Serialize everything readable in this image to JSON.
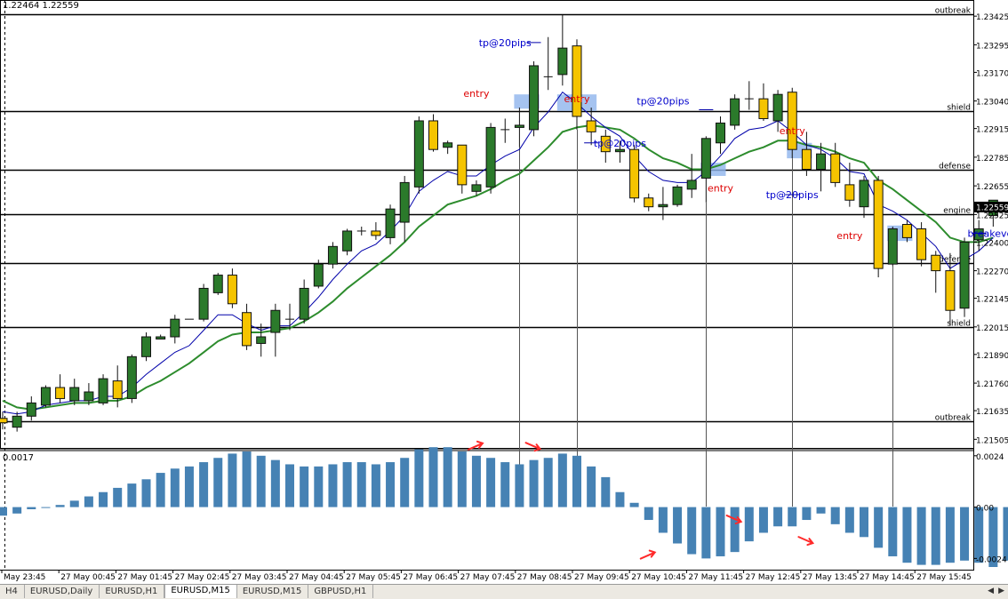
{
  "header": {
    "price_readout": "1.22464 1.22559",
    "indicator_readout": "0.0017"
  },
  "colors": {
    "bull": "#2b7a2b",
    "bear": "#f5c400",
    "wick": "#111111",
    "ma_fast": "#0000aa",
    "ma_slow": "#2d8c2d",
    "histogram": "#4682b4",
    "entry_text": "#dd0000",
    "tp_text": "#0000cc",
    "arrow": "#ff2a2a",
    "zone": "#8fb4ec"
  },
  "tabs": [
    {
      "label": "H4",
      "active": false
    },
    {
      "label": "EURUSD,Daily",
      "active": false
    },
    {
      "label": "EURUSD,H1",
      "active": false
    },
    {
      "label": "EURUSD,M15",
      "active": true
    },
    {
      "label": "EURUSD,M15",
      "active": false
    },
    {
      "label": "GBPUSD,H1",
      "active": false
    }
  ],
  "chart_data": {
    "type": "candlestick",
    "symbol_tab": "EURUSD,M15",
    "price_axis": {
      "ylim": [
        1.2147,
        1.2347
      ],
      "ticks": [
        "1.23425",
        "1.23295",
        "1.23170",
        "1.23040",
        "1.22915",
        "1.22785",
        "1.22655",
        "1.22525",
        "1.22400",
        "1.22270",
        "1.22145",
        "1.22015",
        "1.21890",
        "1.21760",
        "1.21635",
        "1.21505"
      ],
      "current_price": "1.22559"
    },
    "time_labels": [
      "May 23:45",
      "27 May 00:45",
      "27 May 01:45",
      "27 May 02:45",
      "27 May 03:45",
      "27 May 04:45",
      "27 May 05:45",
      "27 May 06:45",
      "27 May 07:45",
      "27 May 08:45",
      "27 May 09:45",
      "27 May 10:45",
      "27 May 11:45",
      "27 May 12:45",
      "27 May 13:45",
      "27 May 14:45",
      "27 May 15:45"
    ],
    "candles": [
      {
        "o": 1.216,
        "h": 1.2163,
        "l": 1.2155,
        "c": 1.2158
      },
      {
        "o": 1.2156,
        "h": 1.2163,
        "l": 1.2154,
        "c": 1.2161
      },
      {
        "o": 1.2161,
        "h": 1.217,
        "l": 1.2159,
        "c": 1.2167
      },
      {
        "o": 1.2166,
        "h": 1.2175,
        "l": 1.2165,
        "c": 1.2174
      },
      {
        "o": 1.2174,
        "h": 1.218,
        "l": 1.2167,
        "c": 1.2169
      },
      {
        "o": 1.2168,
        "h": 1.2178,
        "l": 1.2166,
        "c": 1.2174
      },
      {
        "o": 1.2168,
        "h": 1.2176,
        "l": 1.2166,
        "c": 1.2172
      },
      {
        "o": 1.2167,
        "h": 1.218,
        "l": 1.2166,
        "c": 1.2178
      },
      {
        "o": 1.2177,
        "h": 1.2184,
        "l": 1.2165,
        "c": 1.2169
      },
      {
        "o": 1.2169,
        "h": 1.2189,
        "l": 1.2167,
        "c": 1.2188
      },
      {
        "o": 1.2188,
        "h": 1.2199,
        "l": 1.2186,
        "c": 1.2197
      },
      {
        "o": 1.2196,
        "h": 1.2198,
        "l": 1.2196,
        "c": 1.2197
      },
      {
        "o": 1.2197,
        "h": 1.2207,
        "l": 1.2194,
        "c": 1.2205
      },
      {
        "o": 1.2205,
        "h": 1.2205,
        "l": 1.2205,
        "c": 1.2205
      },
      {
        "o": 1.2205,
        "h": 1.2221,
        "l": 1.2204,
        "c": 1.2219
      },
      {
        "o": 1.2217,
        "h": 1.2226,
        "l": 1.2216,
        "c": 1.2225
      },
      {
        "o": 1.2225,
        "h": 1.2228,
        "l": 1.221,
        "c": 1.2212
      },
      {
        "o": 1.2208,
        "h": 1.2212,
        "l": 1.2191,
        "c": 1.2193
      },
      {
        "o": 1.2194,
        "h": 1.2203,
        "l": 1.2188,
        "c": 1.2197
      },
      {
        "o": 1.2199,
        "h": 1.2212,
        "l": 1.2188,
        "c": 1.2209
      },
      {
        "o": 1.2205,
        "h": 1.2212,
        "l": 1.22,
        "c": 1.2205
      },
      {
        "o": 1.2205,
        "h": 1.2223,
        "l": 1.2203,
        "c": 1.2219
      },
      {
        "o": 1.222,
        "h": 1.2232,
        "l": 1.2219,
        "c": 1.223
      },
      {
        "o": 1.223,
        "h": 1.224,
        "l": 1.2228,
        "c": 1.2238
      },
      {
        "o": 1.2236,
        "h": 1.2246,
        "l": 1.2234,
        "c": 1.2245
      },
      {
        "o": 1.2245,
        "h": 1.2247,
        "l": 1.2243,
        "c": 1.2245
      },
      {
        "o": 1.2245,
        "h": 1.2249,
        "l": 1.2241,
        "c": 1.2243
      },
      {
        "o": 1.2242,
        "h": 1.2257,
        "l": 1.2239,
        "c": 1.2255
      },
      {
        "o": 1.2249,
        "h": 1.227,
        "l": 1.224,
        "c": 1.2267
      },
      {
        "o": 1.2265,
        "h": 1.2297,
        "l": 1.2262,
        "c": 1.2295
      },
      {
        "o": 1.2295,
        "h": 1.2298,
        "l": 1.2281,
        "c": 1.2282
      },
      {
        "o": 1.2283,
        "h": 1.2286,
        "l": 1.228,
        "c": 1.2285
      },
      {
        "o": 1.2284,
        "h": 1.2284,
        "l": 1.2262,
        "c": 1.2266
      },
      {
        "o": 1.2263,
        "h": 1.2268,
        "l": 1.2261,
        "c": 1.2266
      },
      {
        "o": 1.2265,
        "h": 1.2294,
        "l": 1.2262,
        "c": 1.2292
      },
      {
        "o": 1.2291,
        "h": 1.2296,
        "l": 1.2285,
        "c": 1.2291
      },
      {
        "o": 1.2292,
        "h": 1.2301,
        "l": 1.2283,
        "c": 1.2293
      },
      {
        "o": 1.2291,
        "h": 1.2322,
        "l": 1.2288,
        "c": 1.232
      },
      {
        "o": 1.2315,
        "h": 1.2333,
        "l": 1.2309,
        "c": 1.2315
      },
      {
        "o": 1.2316,
        "h": 1.2343,
        "l": 1.2311,
        "c": 1.2328
      },
      {
        "o": 1.2329,
        "h": 1.2332,
        "l": 1.2291,
        "c": 1.2297
      },
      {
        "o": 1.2295,
        "h": 1.2301,
        "l": 1.2284,
        "c": 1.229
      },
      {
        "o": 1.2288,
        "h": 1.2291,
        "l": 1.2276,
        "c": 1.2281
      },
      {
        "o": 1.2281,
        "h": 1.2286,
        "l": 1.2276,
        "c": 1.2282
      },
      {
        "o": 1.2282,
        "h": 1.2284,
        "l": 1.2258,
        "c": 1.226
      },
      {
        "o": 1.226,
        "h": 1.2262,
        "l": 1.2254,
        "c": 1.2256
      },
      {
        "o": 1.2256,
        "h": 1.2265,
        "l": 1.225,
        "c": 1.2257
      },
      {
        "o": 1.2257,
        "h": 1.2266,
        "l": 1.2256,
        "c": 1.2265
      },
      {
        "o": 1.2264,
        "h": 1.228,
        "l": 1.226,
        "c": 1.2268
      },
      {
        "o": 1.2269,
        "h": 1.2288,
        "l": 1.2258,
        "c": 1.2287
      },
      {
        "o": 1.2285,
        "h": 1.2297,
        "l": 1.228,
        "c": 1.2294
      },
      {
        "o": 1.2293,
        "h": 1.2307,
        "l": 1.2291,
        "c": 1.2305
      },
      {
        "o": 1.2305,
        "h": 1.2313,
        "l": 1.23,
        "c": 1.2305
      },
      {
        "o": 1.2305,
        "h": 1.2312,
        "l": 1.2295,
        "c": 1.2296
      },
      {
        "o": 1.2295,
        "h": 1.2309,
        "l": 1.229,
        "c": 1.2307
      },
      {
        "o": 1.2308,
        "h": 1.231,
        "l": 1.2278,
        "c": 1.2282
      },
      {
        "o": 1.2282,
        "h": 1.229,
        "l": 1.227,
        "c": 1.2273
      },
      {
        "o": 1.2273,
        "h": 1.2285,
        "l": 1.2263,
        "c": 1.228
      },
      {
        "o": 1.228,
        "h": 1.2285,
        "l": 1.2265,
        "c": 1.2267
      },
      {
        "o": 1.2266,
        "h": 1.2276,
        "l": 1.2256,
        "c": 1.2259
      },
      {
        "o": 1.2256,
        "h": 1.227,
        "l": 1.2251,
        "c": 1.2268
      },
      {
        "o": 1.2268,
        "h": 1.227,
        "l": 1.2224,
        "c": 1.2228
      },
      {
        "o": 1.223,
        "h": 1.2247,
        "l": 1.2229,
        "c": 1.2246
      },
      {
        "o": 1.2248,
        "h": 1.225,
        "l": 1.224,
        "c": 1.2242
      },
      {
        "o": 1.2246,
        "h": 1.2249,
        "l": 1.2229,
        "c": 1.2232
      },
      {
        "o": 1.2234,
        "h": 1.2236,
        "l": 1.2217,
        "c": 1.2227
      },
      {
        "o": 1.2227,
        "h": 1.2235,
        "l": 1.2202,
        "c": 1.2209
      },
      {
        "o": 1.221,
        "h": 1.2242,
        "l": 1.2206,
        "c": 1.224
      },
      {
        "o": 1.2241,
        "h": 1.225,
        "l": 1.2236,
        "c": 1.2246
      },
      {
        "o": 1.2252,
        "h": 1.2259,
        "l": 1.2247,
        "c": 1.2259
      }
    ],
    "ma_fast": [
      1.2163,
      1.2162,
      1.2163,
      1.2166,
      1.2167,
      1.2168,
      1.2168,
      1.217,
      1.217,
      1.2174,
      1.218,
      1.2185,
      1.219,
      1.2193,
      1.22,
      1.2207,
      1.2207,
      1.2203,
      1.22,
      1.2202,
      1.2202,
      1.2208,
      1.2215,
      1.2223,
      1.223,
      1.2236,
      1.2239,
      1.2245,
      1.2252,
      1.2263,
      1.2268,
      1.2272,
      1.227,
      1.227,
      1.2275,
      1.2279,
      1.2282,
      1.2292,
      1.2299,
      1.2308,
      1.2303,
      1.2297,
      1.2292,
      1.2288,
      1.2279,
      1.2272,
      1.2268,
      1.2267,
      1.2267,
      1.2272,
      1.2279,
      1.2287,
      1.2291,
      1.2292,
      1.2295,
      1.229,
      1.2284,
      1.2282,
      1.2278,
      1.2272,
      1.2271,
      1.2257,
      1.2254,
      1.225,
      1.2244,
      1.2238,
      1.2228,
      1.2232,
      1.2236,
      1.2242
    ],
    "ma_slow": [
      1.2168,
      1.2165,
      1.2164,
      1.2165,
      1.2166,
      1.2167,
      1.2167,
      1.2168,
      1.2168,
      1.217,
      1.2174,
      1.2177,
      1.2181,
      1.2185,
      1.219,
      1.2195,
      1.2198,
      1.2199,
      1.2199,
      1.22,
      1.2201,
      1.2204,
      1.2208,
      1.2213,
      1.2219,
      1.2224,
      1.2229,
      1.2234,
      1.224,
      1.2247,
      1.2252,
      1.2257,
      1.2259,
      1.2261,
      1.2264,
      1.2268,
      1.2271,
      1.2277,
      1.2283,
      1.229,
      1.2292,
      1.2293,
      1.2292,
      1.2291,
      1.2287,
      1.2282,
      1.2278,
      1.2276,
      1.2273,
      1.2273,
      1.2275,
      1.2278,
      1.2281,
      1.2283,
      1.2286,
      1.2286,
      1.2284,
      1.2283,
      1.2281,
      1.2278,
      1.2276,
      1.2268,
      1.2264,
      1.2259,
      1.2254,
      1.2249,
      1.2242,
      1.224,
      1.224,
      1.2242
    ],
    "levels": [
      {
        "label": "outbreak",
        "price": 1.23435
      },
      {
        "label": "shield",
        "price": 1.22995
      },
      {
        "label": "defense",
        "price": 1.2273
      },
      {
        "label": "engine",
        "price": 1.22525
      },
      {
        "label": "defense",
        "price": 1.22305
      },
      {
        "label": "shield",
        "price": 1.22015
      },
      {
        "label": "outbreak",
        "price": 1.21585
      }
    ],
    "annotations": [
      {
        "text": "tp@20pips",
        "kind": "tp",
        "candle": 35,
        "price": 1.23305
      },
      {
        "text": "entry",
        "kind": "entry",
        "candle": 33,
        "price": 1.23075
      },
      {
        "text": "entry",
        "kind": "entry",
        "candle": 40,
        "price": 1.2305
      },
      {
        "text": "tp@20pips",
        "kind": "tp",
        "candle": 43,
        "price": 1.2285
      },
      {
        "text": "tp@20pips",
        "kind": "tp",
        "candle": 46,
        "price": 1.2304
      },
      {
        "text": "entry",
        "kind": "entry",
        "candle": 55,
        "price": 1.22905
      },
      {
        "text": "entry",
        "kind": "entry",
        "candle": 50,
        "price": 1.22645
      },
      {
        "text": "tp@20pips",
        "kind": "tp",
        "candle": 55,
        "price": 1.22615
      },
      {
        "text": "entry",
        "kind": "entry",
        "candle": 59,
        "price": 1.2243
      },
      {
        "text": "breakeven",
        "kind": "tp",
        "candle": 69,
        "price": 1.2244
      }
    ],
    "entry_zones": [
      {
        "from": 36,
        "to": 37,
        "low": 1.23005,
        "high": 1.2307
      },
      {
        "from": 39,
        "to": 41,
        "low": 1.22995,
        "high": 1.2307
      },
      {
        "from": 49,
        "to": 50,
        "low": 1.227,
        "high": 1.2276
      },
      {
        "from": 55,
        "to": 56,
        "low": 1.2278,
        "high": 1.2285
      },
      {
        "from": 62,
        "to": 63,
        "low": 1.22405,
        "high": 1.22475
      }
    ],
    "tp_ticks": [
      {
        "candle": 37,
        "price": 1.23305
      },
      {
        "candle": 41,
        "price": 1.2285
      },
      {
        "candle": 49,
        "price": 1.23
      },
      {
        "candle": 55,
        "price": 1.22615
      },
      {
        "candle": 68,
        "price": 1.2244
      }
    ],
    "vertical_markers": [
      36,
      40,
      49,
      55,
      62
    ],
    "indicator": {
      "ylim": [
        -0.0028,
        0.0026
      ],
      "ticks": [
        "0.0024",
        "0.00",
        "-0.0024"
      ],
      "values": [
        -0.0004,
        -0.0003,
        -0.0001,
        0.0,
        0.0001,
        0.0003,
        0.0005,
        0.0007,
        0.0009,
        0.0011,
        0.0013,
        0.0016,
        0.0018,
        0.0019,
        0.0021,
        0.0023,
        0.0025,
        0.0026,
        0.0024,
        0.0022,
        0.002,
        0.0019,
        0.0019,
        0.002,
        0.0021,
        0.0021,
        0.002,
        0.0021,
        0.0023,
        0.0027,
        0.0028,
        0.0028,
        0.0026,
        0.0024,
        0.0023,
        0.0021,
        0.002,
        0.0022,
        0.0023,
        0.0025,
        0.0024,
        0.0019,
        0.0014,
        0.0007,
        0.0002,
        -0.0006,
        -0.0012,
        -0.0017,
        -0.0022,
        -0.0024,
        -0.0023,
        -0.0021,
        -0.0016,
        -0.0012,
        -0.0009,
        -0.0009,
        -0.0006,
        -0.0003,
        -0.0008,
        -0.0012,
        -0.0014,
        -0.0019,
        -0.0023,
        -0.0026,
        -0.0027,
        -0.0027,
        -0.0026,
        -0.0025,
        -0.0026,
        -0.0028,
        -0.0025,
        -0.002,
        -0.0015
      ],
      "arrows": [
        {
          "candle": 33,
          "value": 0.0029,
          "direction": "up"
        },
        {
          "candle": 37,
          "value": 0.0028,
          "direction": "down"
        },
        {
          "candle": 45,
          "value": -0.0022,
          "direction": "up"
        },
        {
          "candle": 51,
          "value": -0.0006,
          "direction": "down"
        },
        {
          "candle": 56,
          "value": -0.0016,
          "direction": "down"
        }
      ]
    }
  }
}
